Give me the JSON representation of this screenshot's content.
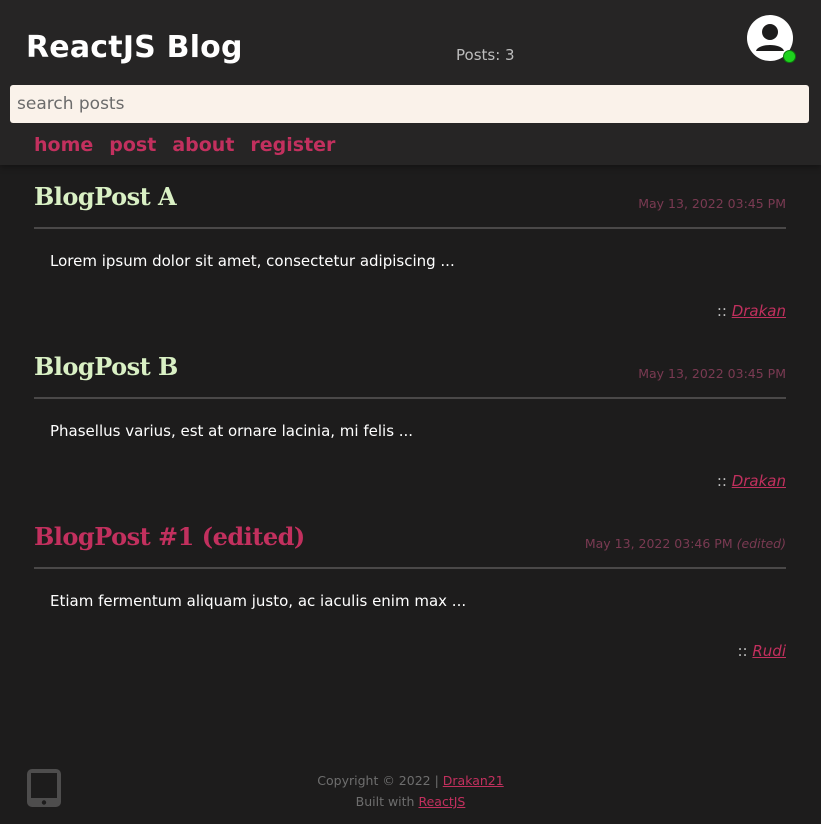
{
  "header": {
    "title": "ReactJS Blog",
    "posts_count": "Posts: 3",
    "avatar_icon": "user-avatar-icon",
    "online_status_color": "#1ed21e"
  },
  "search": {
    "placeholder": "search posts",
    "value": ""
  },
  "nav": {
    "items": [
      {
        "label": "home"
      },
      {
        "label": "post"
      },
      {
        "label": "about"
      },
      {
        "label": "register"
      }
    ],
    "color": "#c2305e"
  },
  "posts": [
    {
      "title": "BlogPost A",
      "title_color": "#d9f0c4",
      "date": "May 13, 2022 03:45 PM",
      "edited": "",
      "body": "Lorem ipsum dolor sit amet, consectetur adipiscing ...",
      "author_prefix": "::",
      "author": "Drakan"
    },
    {
      "title": "BlogPost B",
      "title_color": "#d9f0c4",
      "date": "May 13, 2022 03:45 PM",
      "edited": "",
      "body": "Phasellus varius, est at ornare lacinia, mi felis ...",
      "author_prefix": "::",
      "author": "Drakan"
    },
    {
      "title": "BlogPost #1 (edited)",
      "title_color": "#c2305e",
      "date": "May 13, 2022 03:46 PM",
      "edited": "(edited)",
      "body": "Etiam fermentum aliquam justo, ac iaculis enim max ...",
      "author_prefix": "::",
      "author": "Rudi"
    }
  ],
  "footer": {
    "device_icon": "tablet-icon",
    "copyright_prefix": "Copyright © 2022 |",
    "copyright_link": "Drakan21",
    "built_prefix": "Built with",
    "built_link": "ReactJS"
  }
}
